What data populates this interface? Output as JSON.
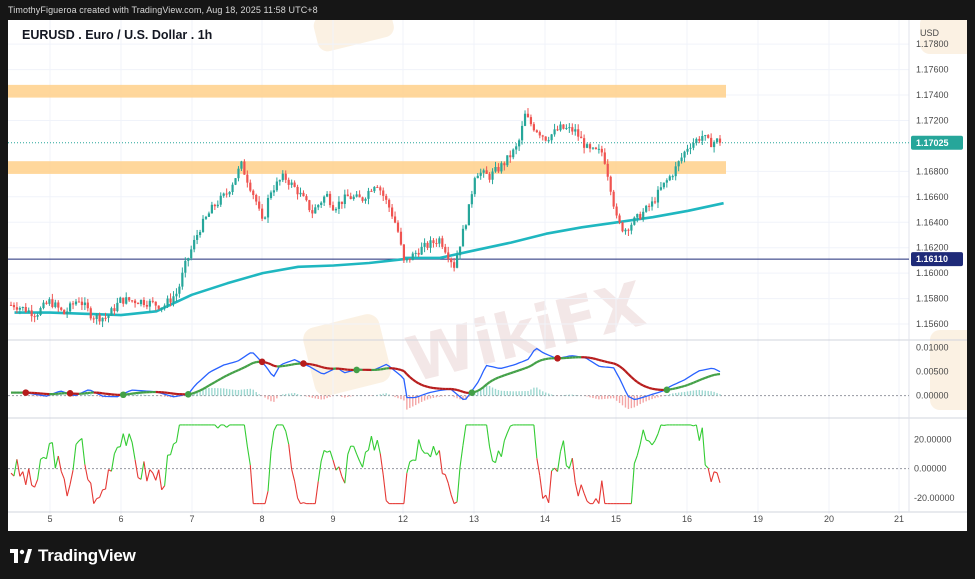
{
  "caption": "TimothyFigueroa created with TradingView.com, Aug 18, 2025 11:58 UTC+8",
  "symbol_title": "EURUSD . Euro / U.S. Dollar . 1h",
  "brand": "TradingView",
  "watermark": "WikiFX",
  "colors": {
    "up": "#26a69a",
    "down": "#ef5350",
    "ma": "#1fb7c0",
    "zone": "#ffd08a",
    "price_tag": "#26a69a",
    "level_tag": "#1e2a78",
    "macd_line": "#2962ff",
    "signal_line_up": "#43a047",
    "signal_line_down": "#b71c1c",
    "hist_pos": "#9ed8d1",
    "hist_neg": "#f4a6a6",
    "osc_up": "#33cc33",
    "osc_down": "#e53935"
  },
  "chart_data": [
    {
      "type": "candlestick",
      "title": "EURUSD . Euro / U.S. Dollar . 1h",
      "currency": "USD",
      "x_ticks": [
        "5",
        "6",
        "7",
        "8",
        "9",
        "12",
        "13",
        "14",
        "15",
        "16",
        "19",
        "20",
        "21"
      ],
      "y_ticks": [
        "1.17800",
        "1.17600",
        "1.17400",
        "1.17200",
        "1.16800",
        "1.16600",
        "1.16400",
        "1.16200",
        "1.16000",
        "1.15800",
        "1.15600"
      ],
      "ylim": [
        1.1549,
        1.1788
      ],
      "current_price": "1.17025",
      "marked_level": "1.16110",
      "resistance_zones": [
        [
          1.1738,
          1.1748
        ],
        [
          1.1678,
          1.1688
        ]
      ],
      "moving_average": [
        [
          4.5,
          1.1569
        ],
        [
          5.0,
          1.1569
        ],
        [
          5.5,
          1.1568
        ],
        [
          6.0,
          1.1567
        ],
        [
          6.5,
          1.157
        ],
        [
          7.0,
          1.1583
        ],
        [
          7.5,
          1.1592
        ],
        [
          8.0,
          1.16
        ],
        [
          8.5,
          1.1605
        ],
        [
          9.0,
          1.1606
        ],
        [
          9.5,
          1.1608
        ],
        [
          10.0,
          1.1611
        ],
        [
          11.0,
          1.1612
        ],
        [
          12.0,
          1.1612
        ],
        [
          12.5,
          1.1612
        ],
        [
          13.0,
          1.1618
        ],
        [
          13.5,
          1.1624
        ],
        [
          14.0,
          1.1631
        ],
        [
          14.5,
          1.1636
        ],
        [
          15.0,
          1.164
        ],
        [
          15.5,
          1.1644
        ],
        [
          16.0,
          1.1649
        ],
        [
          16.5,
          1.1655
        ]
      ],
      "price_path": [
        [
          4.5,
          1.1575
        ],
        [
          4.8,
          1.1568
        ],
        [
          5.0,
          1.1578
        ],
        [
          5.2,
          1.1568
        ],
        [
          5.4,
          1.158
        ],
        [
          5.6,
          1.1566
        ],
        [
          5.8,
          1.1565
        ],
        [
          6.0,
          1.1579
        ],
        [
          6.3,
          1.1578
        ],
        [
          6.6,
          1.1574
        ],
        [
          6.8,
          1.1585
        ],
        [
          6.9,
          1.1605
        ],
        [
          7.1,
          1.1634
        ],
        [
          7.3,
          1.1652
        ],
        [
          7.5,
          1.1663
        ],
        [
          7.7,
          1.1685
        ],
        [
          7.9,
          1.1658
        ],
        [
          8.0,
          1.1638
        ],
        [
          8.1,
          1.1664
        ],
        [
          8.3,
          1.1676
        ],
        [
          8.5,
          1.1664
        ],
        [
          8.7,
          1.1648
        ],
        [
          8.9,
          1.1662
        ],
        [
          9.0,
          1.1652
        ],
        [
          9.2,
          1.166
        ],
        [
          9.4,
          1.1658
        ],
        [
          9.6,
          1.1672
        ],
        [
          9.8,
          1.165
        ],
        [
          9.9,
          1.1635
        ],
        [
          10.0,
          1.1606
        ],
        [
          11.0,
          1.161
        ],
        [
          12.0,
          1.1608
        ],
        [
          12.2,
          1.1618
        ],
        [
          12.5,
          1.1627
        ],
        [
          12.7,
          1.1606
        ],
        [
          12.9,
          1.1648
        ],
        [
          13.0,
          1.168
        ],
        [
          13.2,
          1.1676
        ],
        [
          13.4,
          1.1686
        ],
        [
          13.6,
          1.17
        ],
        [
          13.7,
          1.1724
        ],
        [
          13.8,
          1.1716
        ],
        [
          14.0,
          1.1706
        ],
        [
          14.2,
          1.1714
        ],
        [
          14.4,
          1.1712
        ],
        [
          14.6,
          1.1696
        ],
        [
          14.8,
          1.1695
        ],
        [
          14.9,
          1.167
        ],
        [
          15.0,
          1.164
        ],
        [
          15.1,
          1.1634
        ],
        [
          15.3,
          1.1644
        ],
        [
          15.5,
          1.1655
        ],
        [
          15.6,
          1.1665
        ],
        [
          15.8,
          1.168
        ],
        [
          16.0,
          1.17
        ],
        [
          16.2,
          1.1708
        ],
        [
          16.3,
          1.1702
        ],
        [
          16.4,
          1.1704
        ]
      ],
      "indicator_macd": {
        "y_ticks": [
          "0.01000",
          "0.00500",
          "0.00000"
        ],
        "ylim": [
          -0.003,
          0.0112
        ]
      },
      "indicator_oscillator": {
        "y_ticks": [
          "20.00000",
          "0.00000",
          "-20.00000"
        ],
        "ylim": [
          -27,
          32
        ]
      }
    }
  ]
}
